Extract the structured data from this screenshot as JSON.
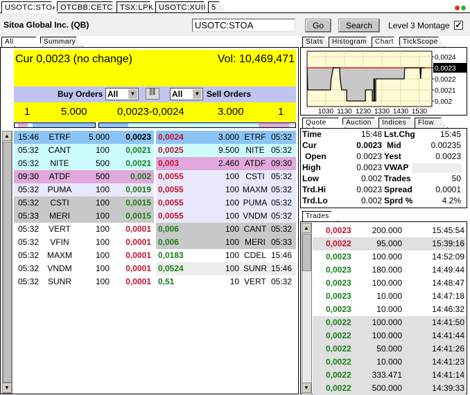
{
  "top_tabs": [
    "USOTC:STOA",
    "OTCBB:CETC",
    "TSX:LPK",
    "USOTC:XUII",
    "5"
  ],
  "header": {
    "title": "Sitoa Global Inc. (QB)",
    "symbol_value": "USOTC:STOA",
    "go_label": "Go",
    "search_label": "Search",
    "level3_label": "Level 3 Montage",
    "level3_checked": true
  },
  "left_tabs": [
    "All orders",
    "Summary"
  ],
  "summary": {
    "cur": "Cur 0,0023 (no change)",
    "vol": "Vol: 10,469,471",
    "buy_label": "Buy Orders",
    "sell_label": "Sell Orders",
    "buy_filter": "All",
    "sell_filter": "All",
    "bid_count": "1",
    "bid_size": "5.000",
    "spread": "0,0023-0,0024",
    "ask_size": "3.000",
    "ask_count": "1"
  },
  "colors": {
    "yellow": "#ffff00",
    "filter_bg": "#c0c4ee",
    "level1": "#8cc4f4",
    "level2": "#ccfcfc",
    "level3": "#e0a8dc",
    "level4": "#e8e8fc",
    "level5": "#c8c8c8",
    "bid_price": "#1a7d1a",
    "ask_price": "#c8102e"
  },
  "bids": [
    {
      "time": "15:46",
      "mm": "ETRF",
      "size": "5.000",
      "price": "0,0023",
      "level": 1,
      "color": "black"
    },
    {
      "time": "05:32",
      "mm": "CANT",
      "size": "100",
      "price": "0,0021",
      "level": 2,
      "color": "green"
    },
    {
      "time": "05:32",
      "mm": "NITE",
      "size": "500",
      "price": "0,0021",
      "level": 2,
      "color": "green"
    },
    {
      "time": "09:30",
      "mm": "ATDF",
      "size": "500",
      "price": "0,002",
      "level": 3,
      "color": "green"
    },
    {
      "time": "05:32",
      "mm": "PUMA",
      "size": "100",
      "price": "0,0019",
      "level": 4,
      "color": "green"
    },
    {
      "time": "05:32",
      "mm": "CSTI",
      "size": "100",
      "price": "0,0015",
      "level": 5,
      "color": "green"
    },
    {
      "time": "05:33",
      "mm": "MERI",
      "size": "100",
      "price": "0,0015",
      "level": 5,
      "color": "green"
    },
    {
      "time": "05:32",
      "mm": "VERT",
      "size": "100",
      "price": "0,0001",
      "level": 0,
      "color": "red"
    },
    {
      "time": "05:32",
      "mm": "VFIN",
      "size": "100",
      "price": "0,0001",
      "level": 0,
      "color": "red"
    },
    {
      "time": "05:32",
      "mm": "MAXM",
      "size": "100",
      "price": "0,0001",
      "level": 0,
      "color": "red"
    },
    {
      "time": "05:32",
      "mm": "VNDM",
      "size": "100",
      "price": "0,0001",
      "level": 0,
      "color": "red"
    },
    {
      "time": "05:32",
      "mm": "SUNR",
      "size": "100",
      "price": "0,0001",
      "level": 0,
      "color": "red"
    }
  ],
  "asks": [
    {
      "price": "0,0024",
      "size": "3.000",
      "mm": "ETRF",
      "time": "05:32",
      "level": 1,
      "color": "red"
    },
    {
      "price": "0,0025",
      "size": "9.500",
      "mm": "NITE",
      "time": "05:32",
      "level": 2,
      "color": "red"
    },
    {
      "price": "0,003",
      "size": "2.460",
      "mm": "ATDF",
      "time": "09:30",
      "level": 3,
      "color": "red"
    },
    {
      "price": "0,0055",
      "size": "100",
      "mm": "CSTI",
      "time": "05:32",
      "level": 4,
      "color": "red"
    },
    {
      "price": "0,0055",
      "size": "100",
      "mm": "MAXM",
      "time": "05:32",
      "level": 4,
      "color": "red"
    },
    {
      "price": "0,0055",
      "size": "100",
      "mm": "PUMA",
      "time": "05:32",
      "level": 4,
      "color": "red"
    },
    {
      "price": "0,0055",
      "size": "100",
      "mm": "VNDM",
      "time": "05:32",
      "level": 4,
      "color": "red"
    },
    {
      "price": "0,006",
      "size": "100",
      "mm": "CANT",
      "time": "05:32",
      "level": 5,
      "color": "green"
    },
    {
      "price": "0,006",
      "size": "100",
      "mm": "MERI",
      "time": "05:33",
      "level": 5,
      "color": "green"
    },
    {
      "price": "0,0183",
      "size": "100",
      "mm": "CDEL",
      "time": "15:46",
      "level": 0,
      "color": "green"
    },
    {
      "price": "0,0524",
      "size": "100",
      "mm": "SUNR",
      "time": "15:46",
      "level": 6,
      "color": "green"
    },
    {
      "price": "0,51",
      "size": "10",
      "mm": "VERT",
      "time": "05:32",
      "level": 0,
      "color": "green"
    }
  ],
  "right_tabs": [
    "Stats",
    "Histogram",
    "Chart",
    "TickScope"
  ],
  "chart_data": {
    "type": "line",
    "x_ticks": [
      "1030",
      "1130",
      "1230",
      "1330",
      "1430",
      "1530"
    ],
    "y_ticks": [
      "0,0024",
      "0,0023",
      "0,0022",
      "0,0021",
      "0,002"
    ],
    "current_label": "0,0023",
    "ylim": [
      0.00195,
      0.00245
    ],
    "xlim": [
      "09:30",
      "16:10"
    ],
    "grid": true,
    "series": [
      {
        "points": [
          [
            "09:30",
            0.0023
          ],
          [
            "09:32",
            0.0021
          ],
          [
            "10:45",
            0.0021
          ],
          [
            "10:47",
            0.0022
          ],
          [
            "10:54",
            0.0023
          ],
          [
            "11:14",
            0.0023
          ],
          [
            "11:16",
            0.0022
          ],
          [
            "11:21",
            0.0021
          ],
          [
            "11:37",
            0.0021
          ],
          [
            "11:37",
            0.002
          ],
          [
            "12:37",
            0.002
          ],
          [
            "12:37",
            0.0021
          ],
          [
            "12:59",
            0.0021
          ],
          [
            "12:59",
            0.002
          ],
          [
            "13:04",
            0.002
          ],
          [
            "13:04",
            0.0022
          ],
          [
            "13:06",
            0.0022
          ],
          [
            "13:06",
            0.002
          ],
          [
            "13:10",
            0.002
          ],
          [
            "13:10",
            0.0022
          ],
          [
            "14:41",
            0.0022
          ],
          [
            "14:43",
            0.0023
          ],
          [
            "15:32",
            0.0023
          ],
          [
            "15:34",
            0.0022
          ],
          [
            "15:36",
            0.0023
          ],
          [
            "15:48",
            0.0023
          ]
        ]
      }
    ]
  },
  "quote_tabs": [
    "Quote Info",
    "Auction",
    "Indices",
    "Flow"
  ],
  "quote": [
    {
      "l1": "Time",
      "v1": "15:48",
      "l2": "Lst.Chg",
      "v2": "15:45"
    },
    {
      "l1": "Cur",
      "v1": "0.0023",
      "l2": "Mid",
      "v2": "0.00235"
    },
    {
      "l1": "Open",
      "v1": "0.0023",
      "l2": "Yest",
      "v2": "0.0023"
    },
    {
      "l1": "High",
      "v1": "0.0023",
      "l2": "VWAP",
      "v2": ""
    },
    {
      "l1": "Low",
      "v1": "0.002",
      "l2": "Trades",
      "v2": "50"
    },
    {
      "l1": "Trd.Hi",
      "v1": "0.0023",
      "l2": "Spread",
      "v2": "0.0001"
    },
    {
      "l1": "Trd.Lo",
      "v1": "0.002",
      "l2": "Sprd %",
      "v2": "4.2%"
    }
  ],
  "trades_tab": "Trades",
  "trades": [
    {
      "price": "0,0023",
      "size": "200.000",
      "time": "15:45:54",
      "color": "red",
      "shade": false
    },
    {
      "price": "0,0022",
      "size": "95.000",
      "time": "15:39:16",
      "color": "red",
      "shade": true
    },
    {
      "price": "0,0023",
      "size": "100.000",
      "time": "14:52:09",
      "color": "green",
      "shade": false
    },
    {
      "price": "0,0023",
      "size": "180.000",
      "time": "14:49:44",
      "color": "green",
      "shade": false
    },
    {
      "price": "0,0023",
      "size": "100.000",
      "time": "14:48:47",
      "color": "green",
      "shade": false
    },
    {
      "price": "0,0023",
      "size": "10.000",
      "time": "14:47:18",
      "color": "green",
      "shade": false
    },
    {
      "price": "0,0023",
      "size": "10.000",
      "time": "14:46:32",
      "color": "green",
      "shade": false
    },
    {
      "price": "0,0022",
      "size": "100.000",
      "time": "14:41:50",
      "color": "green",
      "shade": true
    },
    {
      "price": "0,0022",
      "size": "100.000",
      "time": "14:41:44",
      "color": "green",
      "shade": true
    },
    {
      "price": "0,0022",
      "size": "50.000",
      "time": "14:41:26",
      "color": "green",
      "shade": true
    },
    {
      "price": "0,0022",
      "size": "10.000",
      "time": "14:41:23",
      "color": "green",
      "shade": true
    },
    {
      "price": "0,0022",
      "size": "333.471",
      "time": "14:41:14",
      "color": "green",
      "shade": true
    },
    {
      "price": "0,0022",
      "size": "500.000",
      "time": "14:39:33",
      "color": "green",
      "shade": true
    }
  ]
}
